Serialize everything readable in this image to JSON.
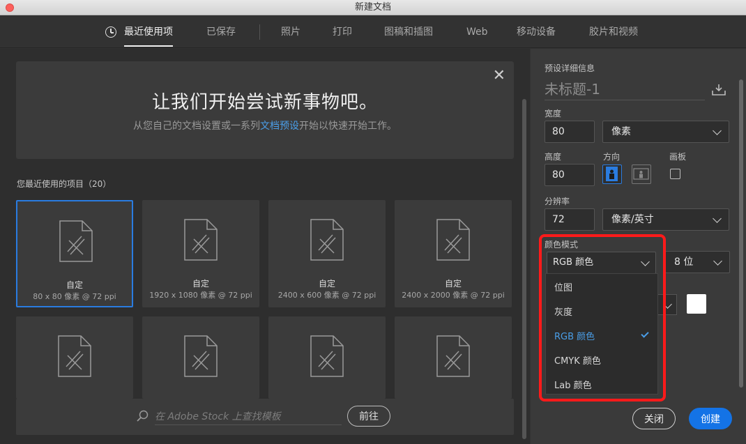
{
  "window": {
    "title": "新建文档"
  },
  "tabs": [
    {
      "label": "最近使用项"
    },
    {
      "label": "已保存"
    },
    {
      "label": "照片"
    },
    {
      "label": "打印"
    },
    {
      "label": "图稿和插图"
    },
    {
      "label": "Web"
    },
    {
      "label": "移动设备"
    },
    {
      "label": "胶片和视频"
    }
  ],
  "hero": {
    "title": "让我们开始尝试新事物吧。",
    "sub_before": "从您自己的文档设置或一系列",
    "sub_link": "文档预设",
    "sub_after": "开始以快速开始工作。"
  },
  "recent": {
    "label": "您最近使用的项目（20）",
    "items": [
      {
        "name": "自定",
        "dims": "80 x 80 像素 @ 72 ppi"
      },
      {
        "name": "自定",
        "dims": "1920 x 1080 像素 @ 72 ppi"
      },
      {
        "name": "自定",
        "dims": "2400 x 600 像素 @ 72 ppi"
      },
      {
        "name": "自定",
        "dims": "2400 x 2000 像素 @ 72 ppi"
      }
    ]
  },
  "stock": {
    "placeholder": "在 Adobe Stock 上查找模板",
    "go_label": "前往"
  },
  "details": {
    "section_label": "预设详细信息",
    "name": "未标题-1",
    "width_label": "宽度",
    "width_value": "80",
    "width_unit": "像素",
    "height_label": "高度",
    "height_value": "80",
    "orientation_label": "方向",
    "artboard_label": "画板",
    "resolution_label": "分辨率",
    "resolution_value": "72",
    "resolution_unit": "像素/英寸",
    "colormode_label": "颜色模式",
    "colormode_value": "RGB 颜色",
    "bitdepth_value": "8 位"
  },
  "colormode_menu": {
    "options": [
      "位图",
      "灰度",
      "RGB 颜色",
      "CMYK 颜色",
      "Lab 颜色"
    ],
    "selected": "RGB 颜色"
  },
  "footer": {
    "close_label": "关闭",
    "create_label": "创建"
  },
  "colors": {
    "accent": "#1473e6",
    "link": "#4a9ee8",
    "highlight": "#ff1a1a"
  }
}
